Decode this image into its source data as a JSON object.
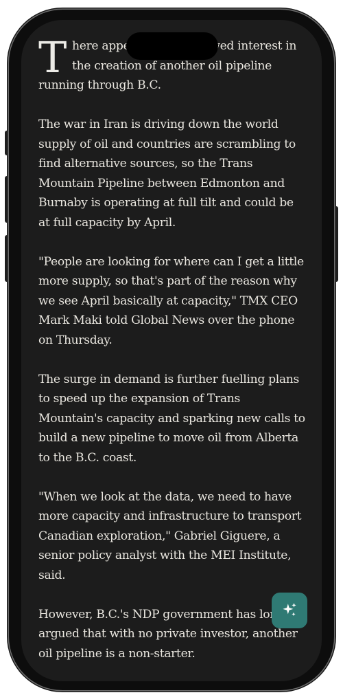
{
  "article": {
    "drop_cap": "T",
    "paragraphs": [
      "here appears to be renewed interest in the creation of another oil pipeline running through B.C.",
      "The war in Iran is driving down the world supply of oil and countries are scrambling to find alternative sources, so the Trans Mountain Pipeline between Edmonton and Burnaby is operating at full tilt and could be at full capacity by April.",
      "\"People are looking for where can I get a little more supply, so that's part of the reason why we see April basically at capacity,\" TMX CEO Mark Maki told Global News over the phone on Thursday.",
      "The surge in demand is further fuelling plans to speed up the expansion of Trans Mountain's capacity and sparking new calls to build a new pipeline to move oil from Alberta to the B.C. coast.",
      "\"When we look at the data, we need to have more capacity and infrastructure to transport Canadian exploration,\" Gabriel Giguere, a senior policy analyst with the MEI Institute, said.",
      "However, B.C.'s NDP government has long argued that with no private investor, another oil pipeline is a non-starter."
    ]
  },
  "ai_button": {
    "icon": "sparkles-icon",
    "color": "#2f7a74"
  },
  "colors": {
    "background": "#1c1c1c",
    "text": "#e9e6df"
  }
}
